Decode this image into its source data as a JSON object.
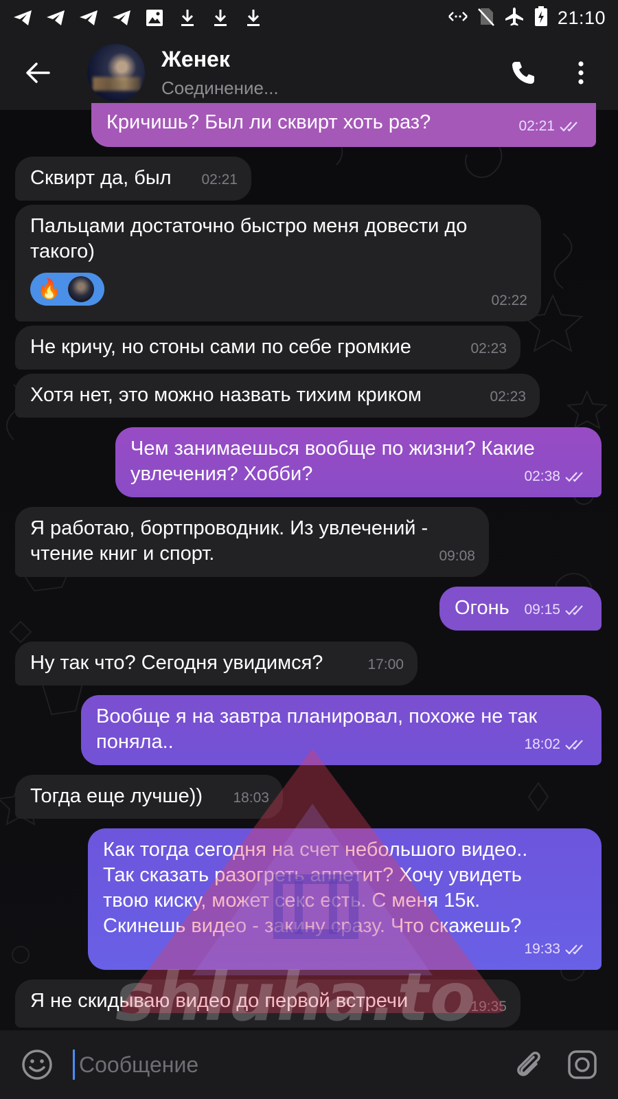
{
  "status_bar": {
    "time": "21:10",
    "left_icons": [
      "telegram-icon",
      "telegram-icon",
      "telegram-icon",
      "telegram-icon",
      "image-icon",
      "download-icon",
      "download-icon",
      "download-icon"
    ],
    "right_icons": [
      "data-arrows-icon",
      "no-sim-icon",
      "airplane-icon",
      "battery-charging-icon"
    ]
  },
  "header": {
    "contact_name": "Женек",
    "status": "Соединение..."
  },
  "colors": {
    "incoming_bubble": "#222225",
    "outgoing_top": "#a259c8",
    "outgoing_bottom": "#6b63e8",
    "reaction_bg": "#4a90e8",
    "caret": "#4b8df8"
  },
  "messages": [
    {
      "dir": "out",
      "text": "Кричишь? Был ли сквирт хоть раз?",
      "time": "02:21",
      "read": true
    },
    {
      "dir": "in",
      "text": "Сквирт да, был",
      "time": "02:21"
    },
    {
      "dir": "in",
      "text": "Пальцами достаточно быстро меня довести до\nтакого)",
      "time": "02:22",
      "reaction": "🔥"
    },
    {
      "dir": "in",
      "text": "Не кричу, но стоны сами по себе громкие",
      "time": "02:23"
    },
    {
      "dir": "in",
      "text": "Хотя нет, это можно назвать тихим криком",
      "time": "02:23"
    },
    {
      "dir": "out",
      "text": "Чем занимаешься вообще по жизни? Какие\nувлечения? Хобби?",
      "time": "02:38",
      "read": true
    },
    {
      "dir": "in",
      "text": "Я работаю, бортпроводник. Из увлечений -\nчтение книг и спорт.",
      "time": "09:08"
    },
    {
      "dir": "out",
      "text": "Огонь",
      "time": "09:15",
      "read": true
    },
    {
      "dir": "in",
      "text": "Ну так что? Сегодня увидимся?",
      "time": "17:00"
    },
    {
      "dir": "out",
      "text": "Вообще я на завтра планировал, похоже не так\nпоняла..",
      "time": "18:02",
      "read": true
    },
    {
      "dir": "in",
      "text": "Тогда еще лучше))",
      "time": "18:03"
    },
    {
      "dir": "out",
      "text": "Как тогда сегодня на счет небольшого видео..\nТак сказать разогреть аппетит? Хочу увидеть\nтвою киску, может секс есть. С меня 15к.\nСкинешь видео - закину сразу. Что скажешь?",
      "time": "19:33",
      "read": true
    },
    {
      "dir": "in",
      "text": "Я не скидываю видео до первой встречи",
      "time": "19:35"
    }
  ],
  "composer": {
    "placeholder": "Сообщение"
  },
  "watermark": {
    "text": "shluha.to"
  }
}
